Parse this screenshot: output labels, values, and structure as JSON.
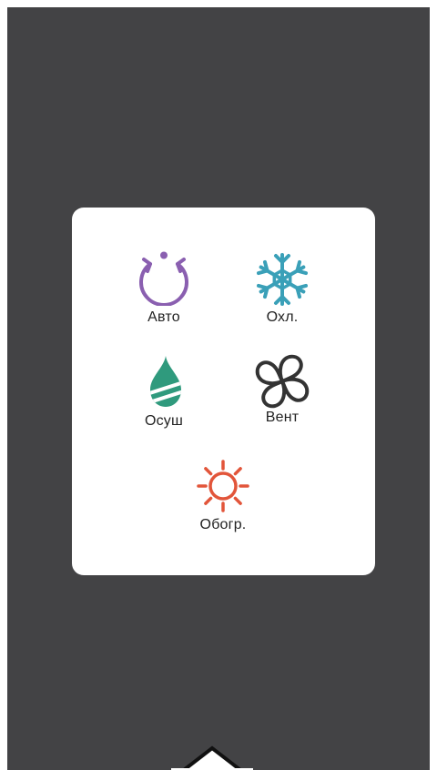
{
  "modes": [
    {
      "id": "auto",
      "label": "Авто",
      "icon": "auto-cycle-icon",
      "color": "#8a5fb0"
    },
    {
      "id": "cool",
      "label": "Охл.",
      "icon": "snowflake-icon",
      "color": "#3aa0b8"
    },
    {
      "id": "dry",
      "label": "Осуш",
      "icon": "water-drop-icon",
      "color": "#2f9a7d"
    },
    {
      "id": "fan",
      "label": "Вент",
      "icon": "fan-icon",
      "color": "#333333"
    },
    {
      "id": "heat",
      "label": "Обогр.",
      "icon": "sun-icon",
      "color": "#e2553a"
    }
  ],
  "colors": {
    "backdrop": "#434345",
    "panel": "#ffffff"
  }
}
